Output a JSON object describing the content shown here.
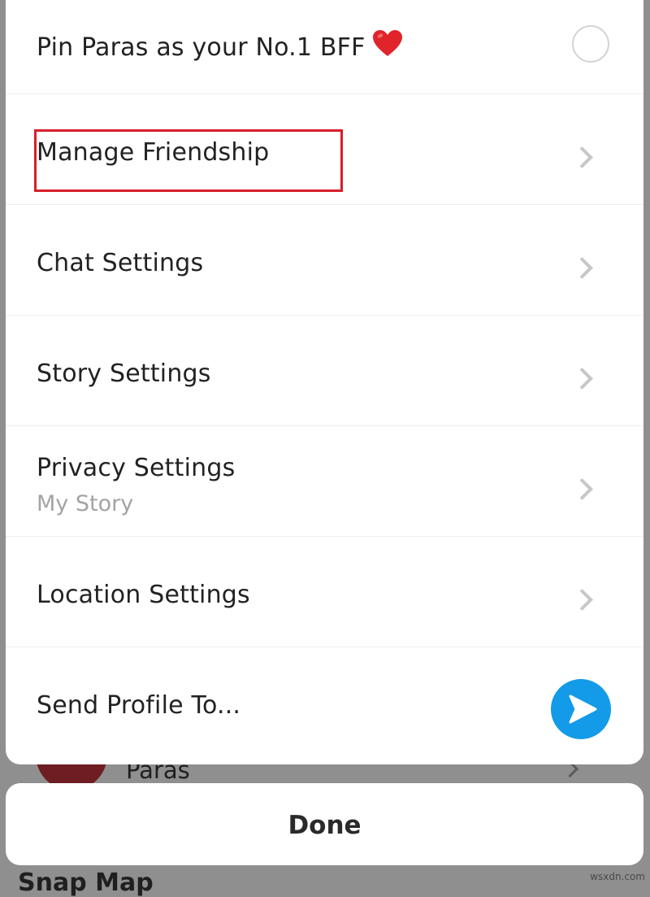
{
  "background": {
    "friend_name": "Paras",
    "section_title": "Snap Map"
  },
  "sheet": {
    "rows": [
      {
        "label": "Pin Paras as your No.1 BFF",
        "control": "radio-unchecked",
        "emoji": "heart"
      },
      {
        "label": "Manage Friendship",
        "control": "chevron",
        "highlighted": true
      },
      {
        "label": "Chat Settings",
        "control": "chevron"
      },
      {
        "label": "Story Settings",
        "control": "chevron"
      },
      {
        "label": "Privacy Settings",
        "sublabel": "My Story",
        "control": "chevron"
      },
      {
        "label": "Location Settings",
        "control": "chevron"
      },
      {
        "label": "Send Profile To...",
        "control": "send-icon"
      }
    ]
  },
  "done_button": {
    "label": "Done"
  },
  "watermark": "wsxdn.com",
  "colors": {
    "highlight_border": "#d61f2a",
    "send_button": "#139ae8",
    "heart": "#e0242c",
    "chevron": "#c7c7c7",
    "sublabel": "#a3a3a3"
  }
}
